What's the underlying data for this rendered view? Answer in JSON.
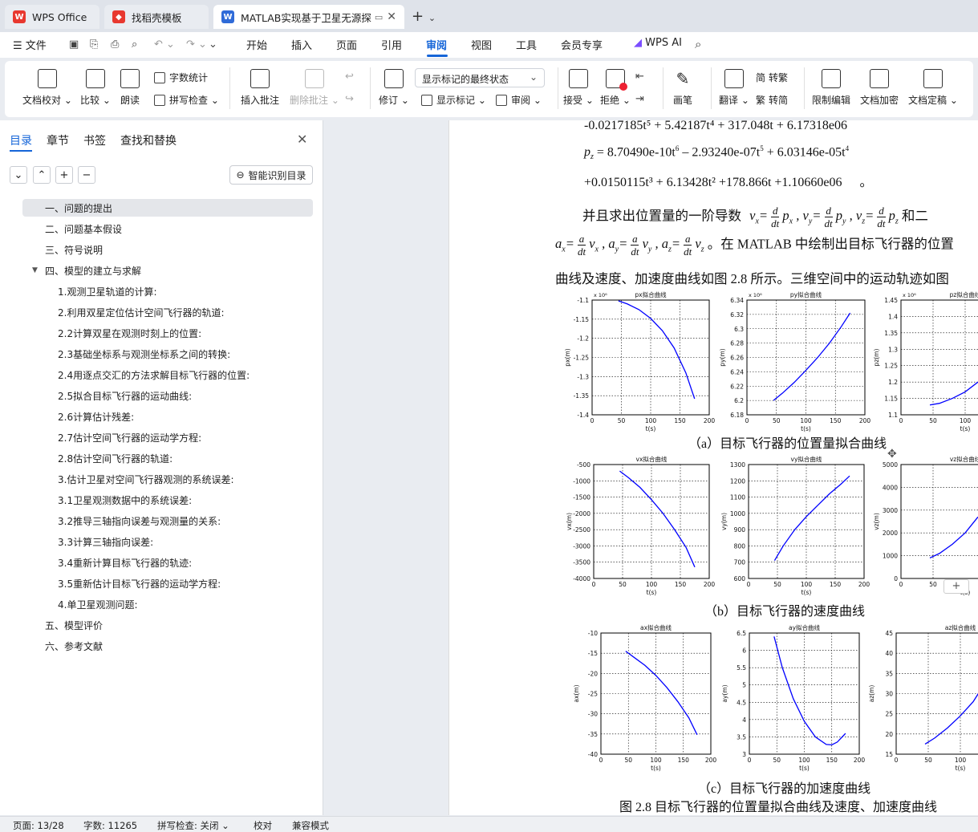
{
  "tabs": [
    {
      "label": "WPS Office"
    },
    {
      "label": "找稻壳模板"
    },
    {
      "label": "MATLAB实现基于卫星无源探"
    }
  ],
  "menu": {
    "file": "文件",
    "items": [
      "开始",
      "插入",
      "页面",
      "引用",
      "审阅",
      "视图",
      "工具",
      "会员专享"
    ],
    "active": "审阅",
    "ai": "WPS AI"
  },
  "ribbon": {
    "doc_check": "文档校对",
    "compare": "比较",
    "read_aloud": "朗读",
    "word_count": "字数统计",
    "spell_check": "拼写检查",
    "insert_comment": "插入批注",
    "delete_comment": "删除批注",
    "revise": "修订",
    "markup_state": "显示标记的最终状态",
    "show_markup": "显示标记",
    "review": "审阅",
    "accept": "接受",
    "reject": "拒绝",
    "pen": "画笔",
    "translate": "翻译",
    "to_traditional": "转繁",
    "to_simplified": "转简",
    "restrict_edit": "限制编辑",
    "encrypt": "文档加密",
    "finalize": "文档定稿"
  },
  "sidebar": {
    "tabs": [
      "目录",
      "章节",
      "书签",
      "查找和替换"
    ],
    "smart_toc": "智能识别目录",
    "toc": [
      {
        "label": "一、问题的提出",
        "level": 1,
        "selected": true
      },
      {
        "label": "二、问题基本假设",
        "level": 1
      },
      {
        "label": "三、符号说明",
        "level": 1
      },
      {
        "label": "四、模型的建立与求解",
        "level": 1,
        "expanded": true
      },
      {
        "label": "1.观测卫星轨道的计算:",
        "level": 2
      },
      {
        "label": "2.利用双星定位估计空间飞行器的轨道:",
        "level": 2
      },
      {
        "label": "2.2计算双星在观测时刻上的位置:",
        "level": 2
      },
      {
        "label": "2.3基础坐标系与观测坐标系之间的转换:",
        "level": 2
      },
      {
        "label": "2.4用逐点交汇的方法求解目标飞行器的位置:",
        "level": 2
      },
      {
        "label": "2.5拟合目标飞行器的运动曲线:",
        "level": 2
      },
      {
        "label": "2.6计算估计残差:",
        "level": 2
      },
      {
        "label": "2.7估计空间飞行器的运动学方程:",
        "level": 2
      },
      {
        "label": "2.8估计空间飞行器的轨道:",
        "level": 2
      },
      {
        "label": "3.估计卫星对空间飞行器观测的系统误差:",
        "level": 2
      },
      {
        "label": "3.1卫星观测数据中的系统误差:",
        "level": 2
      },
      {
        "label": "3.2推导三轴指向误差与观测量的关系:",
        "level": 2
      },
      {
        "label": "3.3计算三轴指向误差:",
        "level": 2
      },
      {
        "label": "3.4重新计算目标飞行器的轨迹:",
        "level": 2
      },
      {
        "label": "3.5重新估计目标飞行器的运动学方程:",
        "level": 2
      },
      {
        "label": "4.单卫星观测问题:",
        "level": 2
      },
      {
        "label": "五、模型评价",
        "level": 1
      },
      {
        "label": "六、参考文献",
        "level": 1
      }
    ]
  },
  "document": {
    "eq1": "-0.0217185t⁵ + 5.42187t⁴ + 317.048t + 6.17318e06",
    "eq2": "p_z = 8.70490e-10t⁶ – 2.93240e-07t⁵ + 6.03146e-05t⁴",
    "eq3": "+0.0150115t³ + 6.13428t² +178.866t +1.10660e06",
    "eq3_end": "。",
    "para1": "并且求出位置量的一阶导数",
    "para1_end": "和二",
    "para2": "。在 MATLAB 中绘制出目标飞行器的位置",
    "para3": "曲线及速度、加速度曲线如图  2.8 所示。三维空间中的运动轨迹如图",
    "caption_a": "（a）目标飞行器的位置量拟合曲线",
    "caption_b": "（b）目标飞行器的速度曲线",
    "caption_c": "（c）目标飞行器的加速度曲线",
    "figure_caption": "图  2.8 目标飞行器的位置量拟合曲线及速度、加速度曲线"
  },
  "chart_data": [
    {
      "type": "line",
      "title": "px拟合曲线",
      "xlabel": "t(s)",
      "ylabel": "px(m)",
      "exponent": "x 10⁶",
      "xlim": [
        0,
        200
      ],
      "ylim": [
        -1.4,
        -1.1
      ],
      "yticks": [
        "-1.1",
        "-1.15",
        "-1.2",
        "-1.25",
        "-1.3",
        "-1.35",
        "-1.4"
      ],
      "xticks": [
        "0",
        "50",
        "100",
        "150",
        "200"
      ],
      "x": [
        45,
        60,
        80,
        100,
        120,
        140,
        160,
        175
      ],
      "y": [
        -1.102,
        -1.11,
        -1.125,
        -1.148,
        -1.18,
        -1.225,
        -1.29,
        -1.358
      ]
    },
    {
      "type": "line",
      "title": "py拟合曲线",
      "xlabel": "t(s)",
      "ylabel": "py(m)",
      "exponent": "x 10⁶",
      "xlim": [
        0,
        200
      ],
      "ylim": [
        6.18,
        6.34
      ],
      "yticks": [
        "6.34",
        "6.32",
        "6.3",
        "6.28",
        "6.26",
        "6.24",
        "6.22",
        "6.2",
        "6.18"
      ],
      "xticks": [
        "0",
        "50",
        "100",
        "150",
        "200"
      ],
      "x": [
        45,
        60,
        80,
        100,
        120,
        140,
        160,
        175
      ],
      "y": [
        6.2,
        6.21,
        6.225,
        6.242,
        6.26,
        6.28,
        6.303,
        6.322
      ]
    },
    {
      "type": "line",
      "title": "pz拟合曲线",
      "xlabel": "t(s)",
      "ylabel": "pz(m)",
      "exponent": "x 10⁶",
      "xlim": [
        0,
        200
      ],
      "ylim": [
        1.1,
        1.45
      ],
      "yticks": [
        "1.45",
        "1.4",
        "1.35",
        "1.3",
        "1.25",
        "1.2",
        "1.15",
        "1.1"
      ],
      "xticks": [
        "0",
        "50",
        "100"
      ],
      "x": [
        45,
        60,
        80,
        100,
        120
      ],
      "y": [
        1.13,
        1.135,
        1.15,
        1.17,
        1.2
      ]
    },
    {
      "type": "line",
      "title": "vx拟合曲线",
      "xlabel": "t(s)",
      "ylabel": "vx(m)",
      "xlim": [
        0,
        200
      ],
      "ylim": [
        -4000,
        -500
      ],
      "yticks": [
        "-500",
        "-1000",
        "-1500",
        "-2000",
        "-2500",
        "-3000",
        "-3500",
        "-4000"
      ],
      "xticks": [
        "0",
        "50",
        "100",
        "150",
        "200"
      ],
      "x": [
        45,
        60,
        80,
        100,
        120,
        140,
        160,
        175
      ],
      "y": [
        -700,
        -900,
        -1200,
        -1580,
        -2000,
        -2500,
        -3050,
        -3650
      ]
    },
    {
      "type": "line",
      "title": "vy拟合曲线",
      "xlabel": "t(s)",
      "ylabel": "vy(m)",
      "xlim": [
        0,
        200
      ],
      "ylim": [
        600,
        1300
      ],
      "yticks": [
        "1300",
        "1200",
        "1100",
        "1000",
        "900",
        "800",
        "700",
        "600"
      ],
      "xticks": [
        "0",
        "50",
        "100",
        "150",
        "200"
      ],
      "x": [
        45,
        60,
        80,
        100,
        120,
        140,
        160,
        175
      ],
      "y": [
        710,
        800,
        900,
        980,
        1050,
        1120,
        1180,
        1230
      ]
    },
    {
      "type": "line",
      "title": "vz拟合曲线",
      "xlabel": "t(s)",
      "ylabel": "vz(m)",
      "xlim": [
        0,
        200
      ],
      "ylim": [
        0,
        5000
      ],
      "yticks": [
        "5000",
        "4000",
        "3000",
        "2000",
        "1000",
        "0"
      ],
      "xticks": [
        "0",
        "50"
      ],
      "x": [
        45,
        60,
        80,
        100,
        120
      ],
      "y": [
        900,
        1100,
        1500,
        2000,
        2700
      ]
    },
    {
      "type": "line",
      "title": "ax拟合曲线",
      "xlabel": "t(s)",
      "ylabel": "ax(m)",
      "xlim": [
        0,
        200
      ],
      "ylim": [
        -40,
        -10
      ],
      "yticks": [
        "-10",
        "-15",
        "-20",
        "-25",
        "-30",
        "-35",
        "-40"
      ],
      "xticks": [
        "0",
        "50",
        "100",
        "150",
        "200"
      ],
      "x": [
        45,
        60,
        80,
        100,
        120,
        140,
        160,
        175
      ],
      "y": [
        -14.5,
        -16,
        -18,
        -20.5,
        -23.5,
        -27,
        -31,
        -35.2
      ]
    },
    {
      "type": "line",
      "title": "ay拟合曲线",
      "xlabel": "t(s)",
      "ylabel": "ay(m)",
      "xlim": [
        0,
        200
      ],
      "ylim": [
        3,
        6.5
      ],
      "yticks": [
        "6.5",
        "6",
        "5.5",
        "5",
        "4.5",
        "4",
        "3.5",
        "3"
      ],
      "xticks": [
        "0",
        "50",
        "100",
        "150",
        "200"
      ],
      "x": [
        45,
        60,
        80,
        100,
        120,
        140,
        150,
        160,
        175
      ],
      "y": [
        6.4,
        5.5,
        4.6,
        3.95,
        3.5,
        3.28,
        3.27,
        3.35,
        3.6
      ]
    },
    {
      "type": "line",
      "title": "az拟合曲线",
      "xlabel": "t(s)",
      "ylabel": "az(m)",
      "xlim": [
        0,
        200
      ],
      "ylim": [
        15,
        45
      ],
      "yticks": [
        "45",
        "40",
        "35",
        "30",
        "25",
        "20",
        "15"
      ],
      "xticks": [
        "0",
        "50",
        "100",
        "15"
      ],
      "x": [
        45,
        60,
        80,
        100,
        120,
        140
      ],
      "y": [
        17.5,
        19,
        21.5,
        24.5,
        28,
        33
      ]
    }
  ],
  "status": {
    "page": "页面: 13/28",
    "words": "字数: 11265",
    "spell": "拼写检查: 关闭",
    "proof": "校对",
    "compat": "兼容模式"
  }
}
